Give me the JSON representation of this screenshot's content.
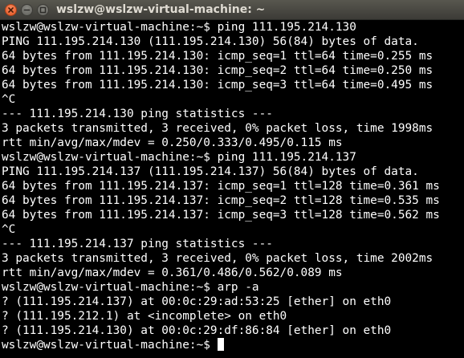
{
  "window": {
    "title": "wslzw@wslzw-virtual-machine: ~",
    "buttons": [
      "close-icon",
      "minimize-icon",
      "maximize-icon"
    ]
  },
  "colors": {
    "terminal_background": "#000000",
    "terminal_text": "#ffffff",
    "titlebar": "#3c3b37",
    "close_button": "#e95420"
  },
  "terminal": {
    "lines": [
      "wslzw@wslzw-virtual-machine:~$ ping 111.195.214.130",
      "PING 111.195.214.130 (111.195.214.130) 56(84) bytes of data.",
      "64 bytes from 111.195.214.130: icmp_seq=1 ttl=64 time=0.255 ms",
      "64 bytes from 111.195.214.130: icmp_seq=2 ttl=64 time=0.250 ms",
      "64 bytes from 111.195.214.130: icmp_seq=3 ttl=64 time=0.495 ms",
      "^C",
      "--- 111.195.214.130 ping statistics ---",
      "3 packets transmitted, 3 received, 0% packet loss, time 1998ms",
      "rtt min/avg/max/mdev = 0.250/0.333/0.495/0.115 ms",
      "wslzw@wslzw-virtual-machine:~$ ping 111.195.214.137",
      "PING 111.195.214.137 (111.195.214.137) 56(84) bytes of data.",
      "64 bytes from 111.195.214.137: icmp_seq=1 ttl=128 time=0.361 ms",
      "64 bytes from 111.195.214.137: icmp_seq=2 ttl=128 time=0.535 ms",
      "64 bytes from 111.195.214.137: icmp_seq=3 ttl=128 time=0.562 ms",
      "^C",
      "--- 111.195.214.137 ping statistics ---",
      "3 packets transmitted, 3 received, 0% packet loss, time 2002ms",
      "rtt min/avg/max/mdev = 0.361/0.486/0.562/0.089 ms",
      "wslzw@wslzw-virtual-machine:~$ arp -a",
      "? (111.195.214.137) at 00:0c:29:ad:53:25 [ether] on eth0",
      "? (111.195.212.1) at <incomplete> on eth0",
      "? (111.195.214.130) at 00:0c:29:df:86:84 [ether] on eth0"
    ],
    "prompt": "wslzw@wslzw-virtual-machine:~$ "
  }
}
